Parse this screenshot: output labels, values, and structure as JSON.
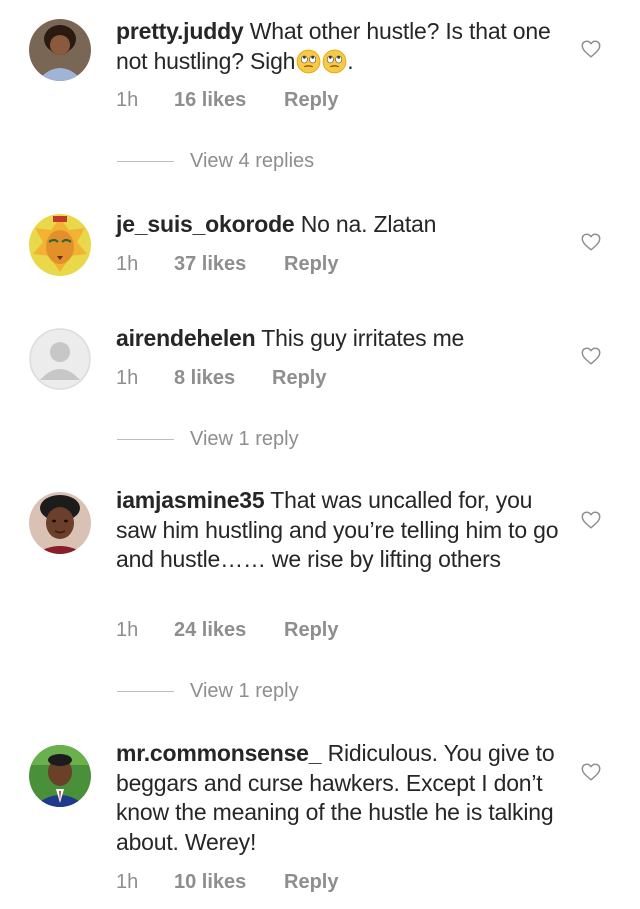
{
  "comments": [
    {
      "username": "pretty.juddy",
      "text": "What other hustle? Is that one not hustling? Sigh",
      "trailing": ".",
      "emoji": [
        "face-with-rolling-eyes-emoji",
        "face-with-rolling-eyes-emoji"
      ],
      "time": "1h",
      "likes": "16 likes",
      "reply_label": "Reply",
      "view_replies": "View 4 replies"
    },
    {
      "username": "je_suis_okorode",
      "text": "No na. Zlatan",
      "time": "1h",
      "likes": "37 likes",
      "reply_label": "Reply"
    },
    {
      "username": "airendehelen",
      "text": "This guy irritates me",
      "time": "1h",
      "likes": "8 likes",
      "reply_label": "Reply",
      "view_replies": "View 1 reply"
    },
    {
      "username": "iamjasmine35",
      "text": "That was uncalled for, you saw him hustling and you’re telling him to go and hustle…… we rise by lifting others",
      "time": "1h",
      "likes": "24 likes",
      "reply_label": "Reply",
      "view_replies": "View 1 reply"
    },
    {
      "username": "mr.commonsense_",
      "text": "Ridiculous. You give to beggars and curse hawkers. Except I don’t know the meaning of the hustle he is talking about. Werey!",
      "time": "1h",
      "likes": "10 likes",
      "reply_label": "Reply"
    }
  ],
  "icons": {
    "like": "heart-outline-icon"
  },
  "colors": {
    "text": "#262626",
    "muted": "#8e8e8e"
  }
}
